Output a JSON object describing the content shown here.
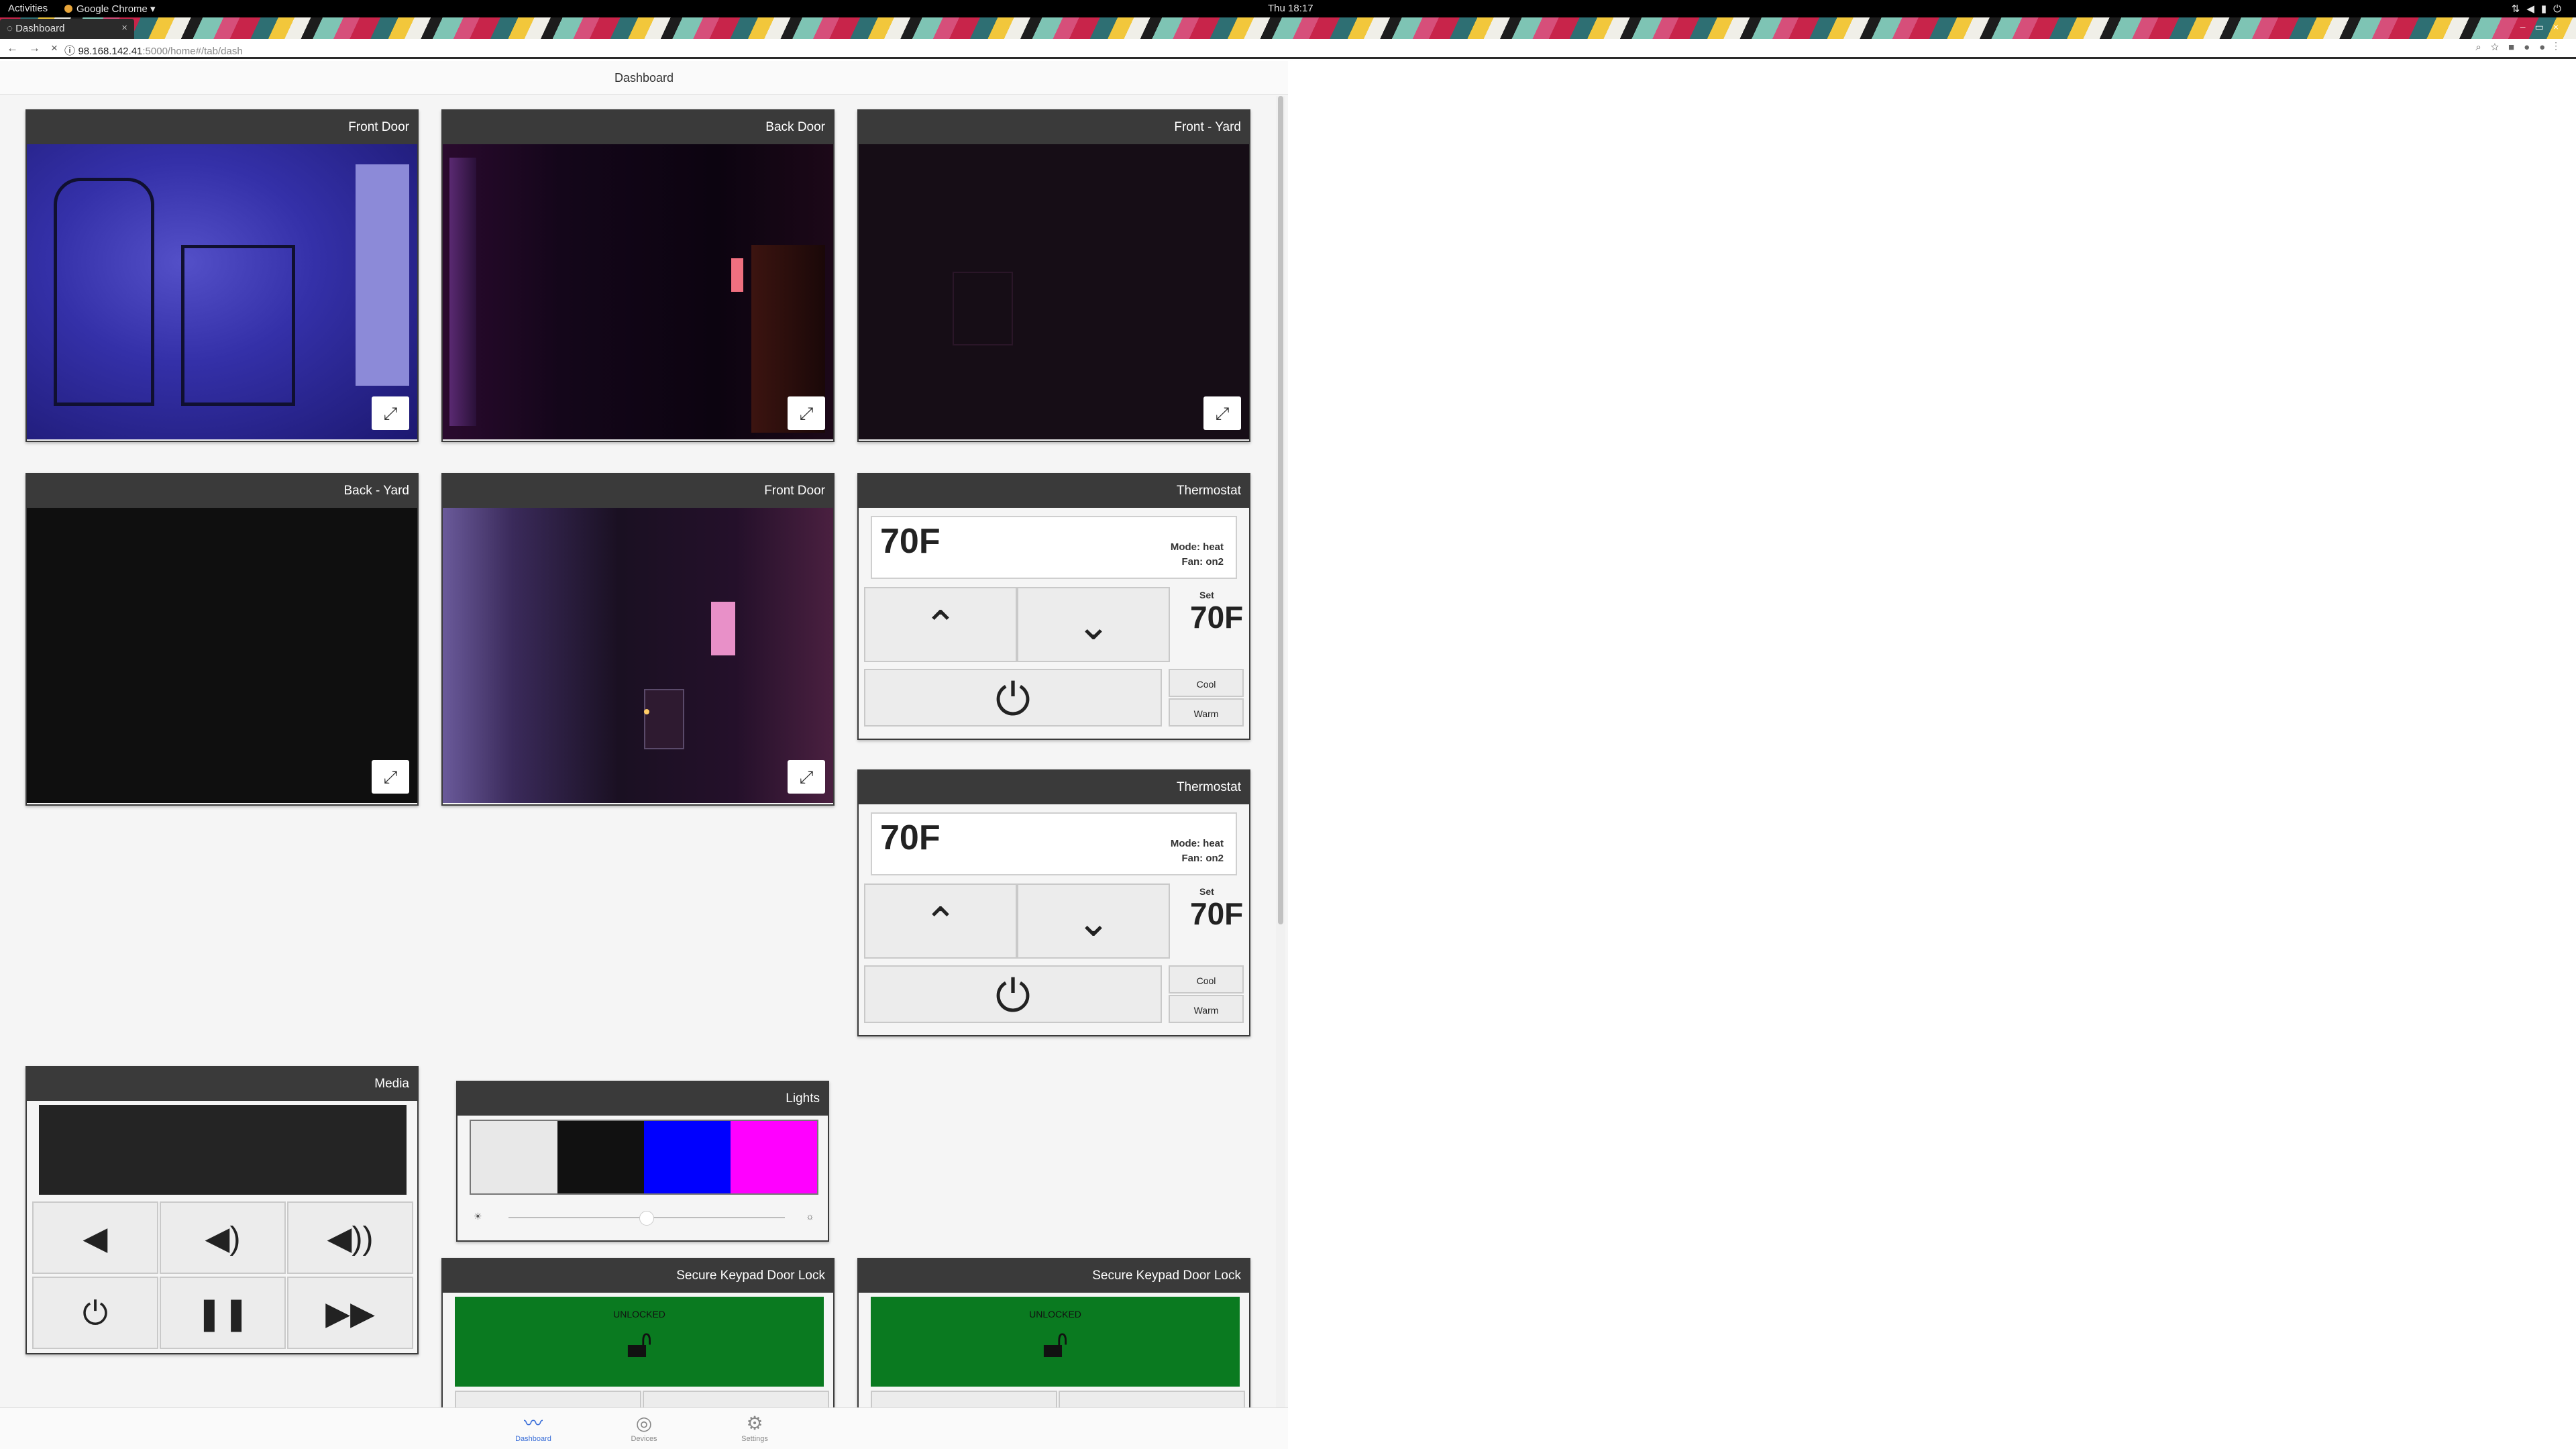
{
  "system": {
    "activities": "Activities",
    "app_name": "Google Chrome",
    "clock": "Thu 18:17",
    "tray_icons": [
      "network-icon",
      "volume-icon",
      "battery-icon",
      "power-icon"
    ]
  },
  "browser": {
    "tab_title": "Dashboard",
    "url_host": "98.168.142.41",
    "url_path": ":5000/home#/tab/dash"
  },
  "page": {
    "title": "Dashboard"
  },
  "cameras": [
    {
      "title": "Front Door"
    },
    {
      "title": "Back Door"
    },
    {
      "title": "Front - Yard"
    },
    {
      "title": "Back - Yard"
    },
    {
      "title": "Front Door"
    }
  ],
  "thermostats": [
    {
      "title": "Thermostat",
      "temp": "70F",
      "mode": "Mode: heat",
      "fan": "Fan: on2",
      "set_label": "Set",
      "set_value": "70F",
      "cool_label": "Cool",
      "warm_label": "Warm"
    },
    {
      "title": "Thermostat",
      "temp": "70F",
      "mode": "Mode: heat",
      "fan": "Fan: on2",
      "set_label": "Set",
      "set_value": "70F",
      "cool_label": "Cool",
      "warm_label": "Warm"
    }
  ],
  "media": {
    "title": "Media"
  },
  "lights": {
    "title": "Lights",
    "swatches": [
      "#e8e8e8",
      "#111111",
      "#0000ff",
      "#ff00ff"
    ],
    "brightness": 0.5
  },
  "locks": [
    {
      "title": "Secure Keypad Door Lock",
      "status": "UNLOCKED"
    },
    {
      "title": "Secure Keypad Door Lock",
      "status": "UNLOCKED"
    }
  ],
  "bottom_nav": [
    {
      "label": "Dashboard",
      "icon": "pulse-icon",
      "active": true
    },
    {
      "label": "Devices",
      "icon": "devices-icon",
      "active": false
    },
    {
      "label": "Settings",
      "icon": "gear-icon",
      "active": false
    }
  ]
}
